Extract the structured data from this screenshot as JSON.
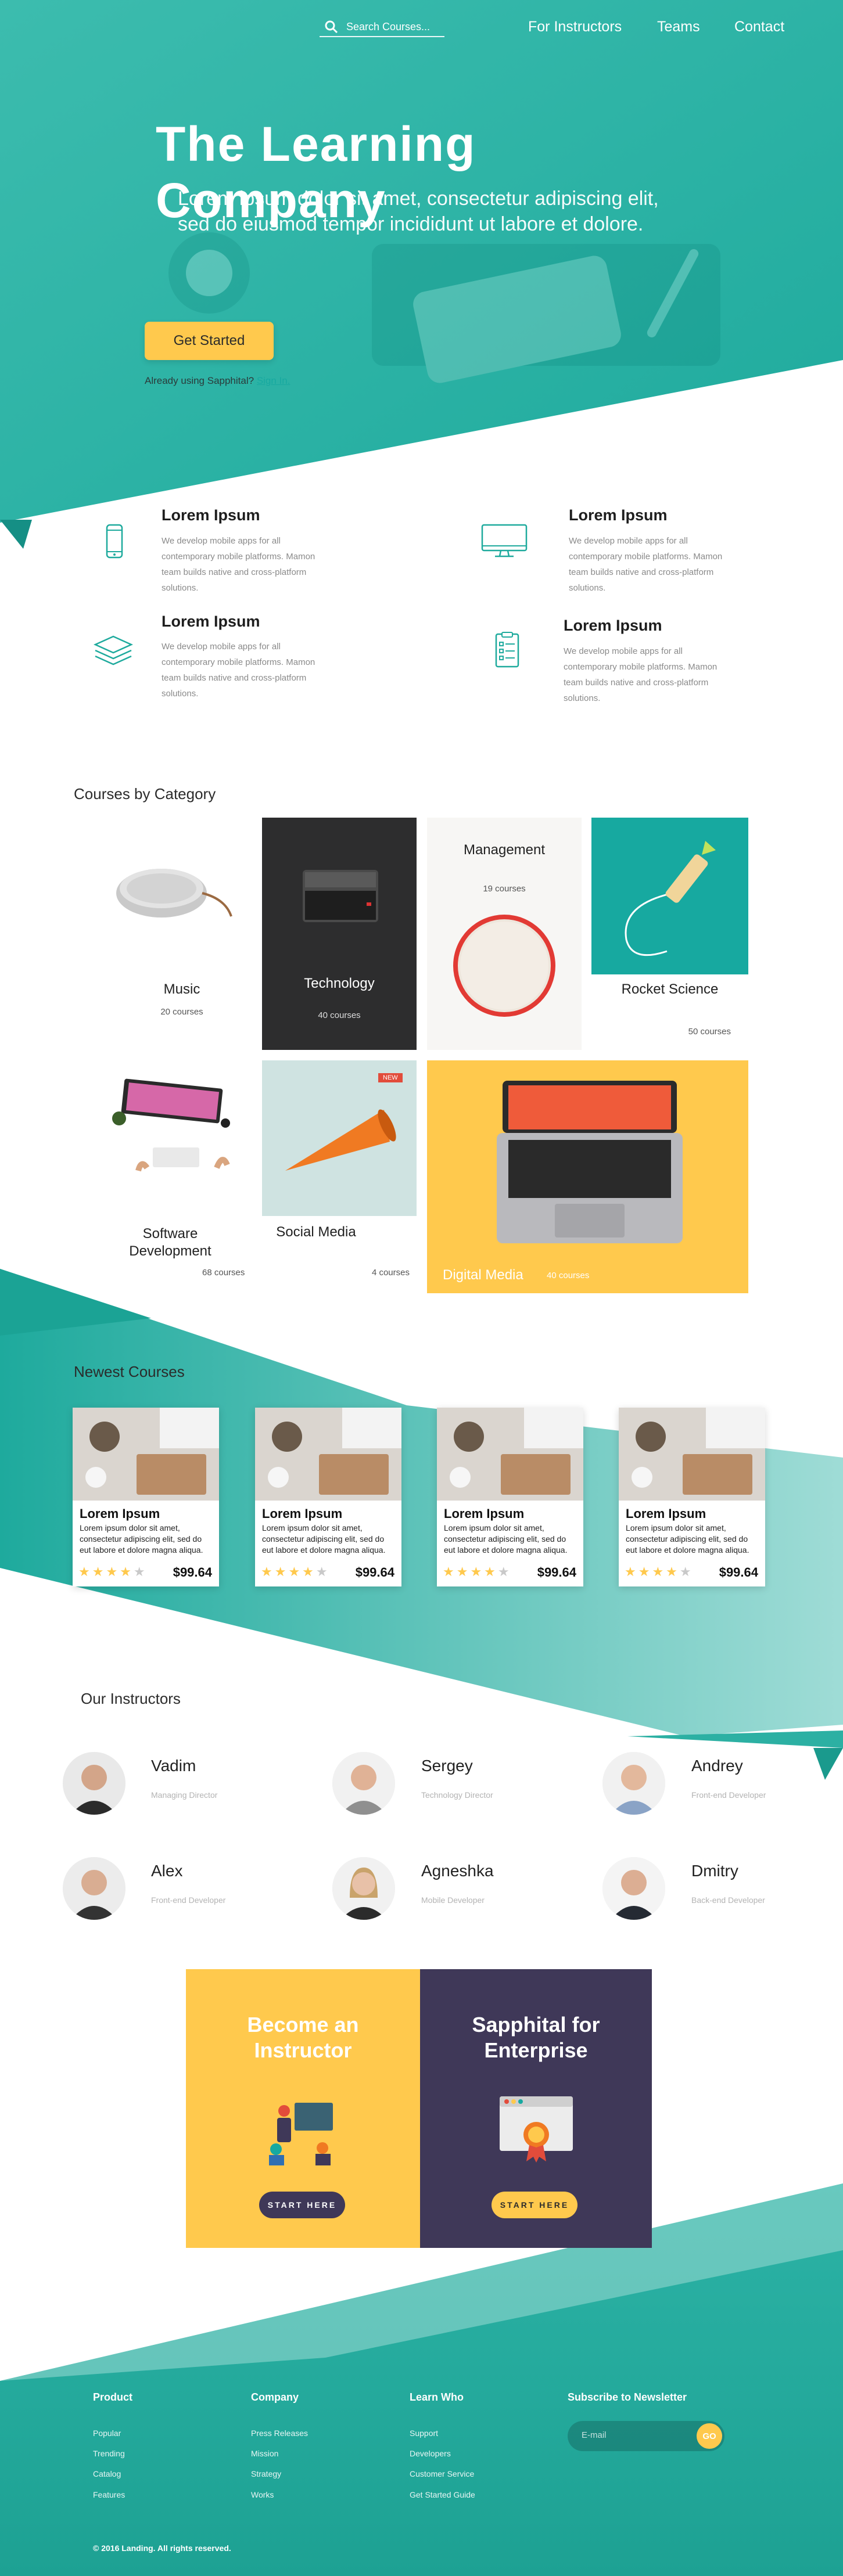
{
  "colors": {
    "teal": "#26b3a6",
    "teal_dark": "#14a196",
    "yellow": "#ffc94d",
    "purple": "#3f3858",
    "dark_card": "#2d2d2e"
  },
  "nav": {
    "search_placeholder": "Search Courses...",
    "links": [
      "For Instructors",
      "Teams",
      "Contact"
    ]
  },
  "hero": {
    "title": "The Learning Company",
    "subtitle": "Lorem ipsum dolor sit amet, consectetur adipiscing elit, sed do eiusmod tempor incididunt ut labore et dolore.",
    "button": "Get Started",
    "already_text": "Already using Sapphital?",
    "signin_link": "Sign In."
  },
  "features": [
    {
      "icon": "smartphone-icon",
      "title": "Lorem Ipsum",
      "text": "We develop mobile apps for all contemporary mobile platforms. Mamon team builds native and cross-platform solutions."
    },
    {
      "icon": "monitor-icon",
      "title": "Lorem Ipsum",
      "text": "We develop mobile apps for all contemporary mobile platforms. Mamon team builds native and cross-platform solutions."
    },
    {
      "icon": "layers-icon",
      "title": "Lorem Ipsum",
      "text": "We develop mobile apps for all contemporary mobile platforms. Mamon team builds native and cross-platform solutions."
    },
    {
      "icon": "checklist-icon",
      "title": "Lorem Ipsum",
      "text": "We develop mobile apps for all contemporary mobile platforms. Mamon team builds native and cross-platform solutions."
    }
  ],
  "categories": {
    "title": "Courses by Category",
    "items": [
      {
        "name": "Music",
        "count": "20 courses"
      },
      {
        "name": "Technology",
        "count": "40 courses"
      },
      {
        "name": "Management",
        "count": "19 courses"
      },
      {
        "name": "Rocket Science",
        "count": "50 courses"
      },
      {
        "name": "Software Development",
        "count": "68 courses"
      },
      {
        "name": "Social Media",
        "count": "4 courses",
        "badge": "NEW"
      },
      {
        "name": "Digital Media",
        "count": "40 courses"
      }
    ]
  },
  "newest": {
    "title": "Newest Courses",
    "cards": [
      {
        "title": "Lorem Ipsum",
        "text": "Lorem ipsum dolor sit amet, consectetur adipiscing elit, sed do eut labore et dolore magna aliqua.",
        "rating": 4,
        "price": "$99.64"
      },
      {
        "title": "Lorem Ipsum",
        "text": "Lorem ipsum dolor sit amet, consectetur adipiscing elit, sed do eut labore et dolore magna aliqua.",
        "rating": 4,
        "price": "$99.64"
      },
      {
        "title": "Lorem Ipsum",
        "text": "Lorem ipsum dolor sit amet, consectetur adipiscing elit, sed do eut labore et dolore magna aliqua.",
        "rating": 4,
        "price": "$99.64"
      },
      {
        "title": "Lorem Ipsum",
        "text": "Lorem ipsum dolor sit amet, consectetur adipiscing elit, sed do eut labore et dolore magna aliqua.",
        "rating": 4,
        "price": "$99.64"
      }
    ]
  },
  "instructors": {
    "title": "Our Instructors",
    "people": [
      {
        "name": "Vadim",
        "role": "Managing Director"
      },
      {
        "name": "Sergey",
        "role": "Technology Director"
      },
      {
        "name": "Andrey",
        "role": "Front-end Developer"
      },
      {
        "name": "Alex",
        "role": "Front-end Developer"
      },
      {
        "name": "Agneshka",
        "role": "Mobile Developer"
      },
      {
        "name": "Dmitry",
        "role": "Back-end Developer"
      }
    ]
  },
  "cta": {
    "instructor": {
      "title_line1": "Become an",
      "title_line2": "Instructor",
      "button": "START HERE"
    },
    "enterprise": {
      "title_line1": "Sapphital for",
      "title_line2": "Enterprise",
      "button": "START HERE"
    }
  },
  "footer": {
    "columns": [
      {
        "title": "Product",
        "links": [
          "Popular",
          "Trending",
          "Catalog",
          "Features"
        ]
      },
      {
        "title": "Company",
        "links": [
          "Press Releases",
          "Mission",
          "Strategy",
          "Works"
        ]
      },
      {
        "title": "Learn Who",
        "links": [
          "Support",
          "Developers",
          "Customer Service",
          "Get Started Guide"
        ]
      }
    ],
    "newsletter": {
      "title": "Subscribe to Newsletter",
      "placeholder": "E-mail",
      "button": "GO"
    },
    "copyright": "© 2016 Landing. All rights reserved."
  }
}
